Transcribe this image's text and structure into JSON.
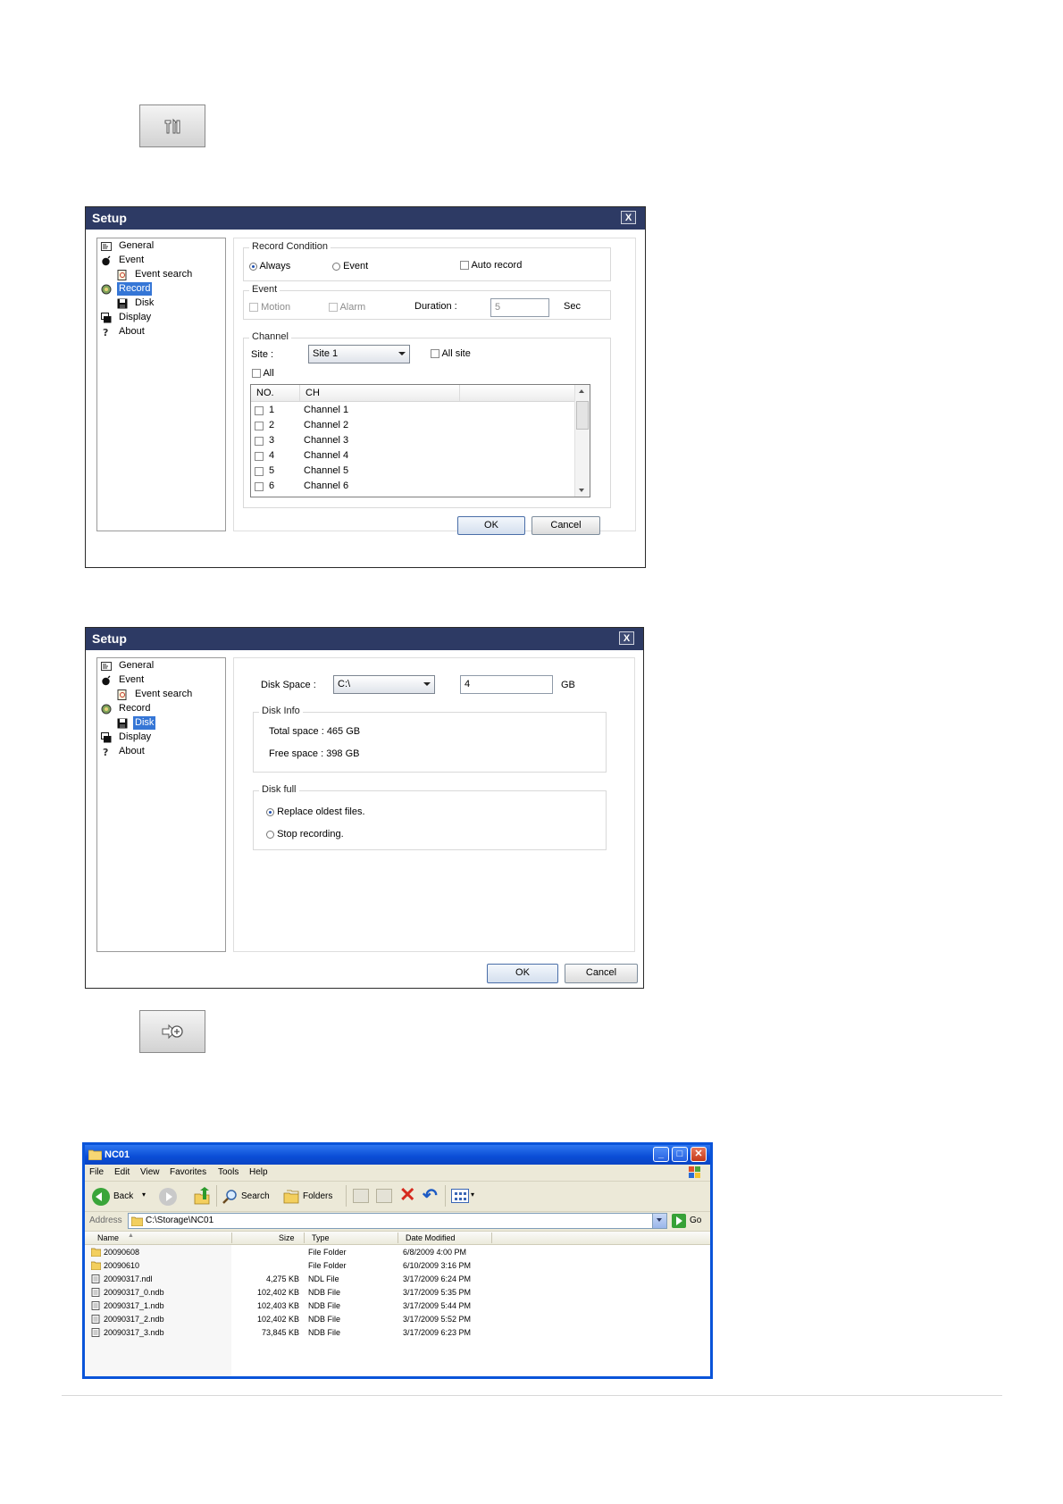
{
  "top_icon_button": {
    "icon": "setup-tool-icon"
  },
  "dialog1": {
    "title": "Setup",
    "close_label": "X",
    "tree": [
      {
        "label": "General",
        "icon": "general-icon",
        "indent": 0,
        "selected": false
      },
      {
        "label": "Event",
        "icon": "event-bomb-icon",
        "indent": 0,
        "selected": false
      },
      {
        "label": "Event search",
        "icon": "event-search-icon",
        "indent": 1,
        "selected": false
      },
      {
        "label": "Record",
        "icon": "record-icon",
        "indent": 0,
        "selected": true
      },
      {
        "label": "Disk",
        "icon": "disk-icon",
        "indent": 1,
        "selected": false
      },
      {
        "label": "Display",
        "icon": "display-icon",
        "indent": 0,
        "selected": false
      },
      {
        "label": "About",
        "icon": "about-icon",
        "indent": 0,
        "selected": false
      }
    ],
    "record_condition": {
      "title": "Record Condition",
      "always": "Always",
      "event": "Event",
      "auto_record": "Auto record"
    },
    "event_group": {
      "title": "Event",
      "motion": "Motion",
      "alarm": "Alarm",
      "duration_label": "Duration :",
      "duration_value": "5",
      "unit": "Sec"
    },
    "channel": {
      "title": "Channel",
      "site_label": "Site :",
      "site_value": "Site 1",
      "all_site": "All site",
      "all": "All",
      "columns": [
        "NO.",
        "CH"
      ],
      "rows": [
        {
          "no": "1",
          "ch": "Channel 1"
        },
        {
          "no": "2",
          "ch": "Channel 2"
        },
        {
          "no": "3",
          "ch": "Channel 3"
        },
        {
          "no": "4",
          "ch": "Channel 4"
        },
        {
          "no": "5",
          "ch": "Channel 5"
        },
        {
          "no": "6",
          "ch": "Channel 6"
        }
      ]
    },
    "ok": "OK",
    "cancel": "Cancel"
  },
  "dialog2": {
    "title": "Setup",
    "close_label": "X",
    "tree": [
      {
        "label": "General",
        "icon": "general-icon",
        "indent": 0,
        "selected": false
      },
      {
        "label": "Event",
        "icon": "event-bomb-icon",
        "indent": 0,
        "selected": false
      },
      {
        "label": "Event search",
        "icon": "event-search-icon",
        "indent": 1,
        "selected": false
      },
      {
        "label": "Record",
        "icon": "record-icon",
        "indent": 0,
        "selected": false
      },
      {
        "label": "Disk",
        "icon": "disk-icon",
        "indent": 1,
        "selected": true
      },
      {
        "label": "Display",
        "icon": "display-icon",
        "indent": 0,
        "selected": false
      },
      {
        "label": "About",
        "icon": "about-icon",
        "indent": 0,
        "selected": false
      }
    ],
    "disk_space_label": "Disk Space :",
    "disk_value": "C:\\",
    "gb_value": "4",
    "gb_unit": "GB",
    "disk_info": {
      "title": "Disk Info",
      "total": "Total space : 465 GB",
      "free": "Free space : 398 GB"
    },
    "disk_full": {
      "title": "Disk full",
      "replace": "Replace oldest files.",
      "stop": "Stop recording."
    },
    "ok": "OK",
    "cancel": "Cancel"
  },
  "second_icon_button": {
    "icon": "export-arrow-icon"
  },
  "explorer": {
    "title": "NC01",
    "menu": [
      "File",
      "Edit",
      "View",
      "Favorites",
      "Tools",
      "Help"
    ],
    "toolbar": {
      "back": "Back",
      "search": "Search",
      "folders": "Folders"
    },
    "address_label": "Address",
    "address_value": "C:\\Storage\\NC01",
    "go": "Go",
    "columns": [
      "Name",
      "Size",
      "Type",
      "Date Modified"
    ],
    "files": [
      {
        "name": "20090608",
        "size": "",
        "type": "File Folder",
        "date": "6/8/2009 4:00 PM",
        "kind": "folder"
      },
      {
        "name": "20090610",
        "size": "",
        "type": "File Folder",
        "date": "6/10/2009 3:16 PM",
        "kind": "folder"
      },
      {
        "name": "20090317.ndl",
        "size": "4,275 KB",
        "type": "NDL File",
        "date": "3/17/2009 6:24 PM",
        "kind": "file"
      },
      {
        "name": "20090317_0.ndb",
        "size": "102,402 KB",
        "type": "NDB File",
        "date": "3/17/2009 5:35 PM",
        "kind": "file"
      },
      {
        "name": "20090317_1.ndb",
        "size": "102,403 KB",
        "type": "NDB File",
        "date": "3/17/2009 5:44 PM",
        "kind": "file"
      },
      {
        "name": "20090317_2.ndb",
        "size": "102,402 KB",
        "type": "NDB File",
        "date": "3/17/2009 5:52 PM",
        "kind": "file"
      },
      {
        "name": "20090317_3.ndb",
        "size": "73,845 KB",
        "type": "NDB File",
        "date": "3/17/2009 6:23 PM",
        "kind": "file"
      }
    ]
  }
}
